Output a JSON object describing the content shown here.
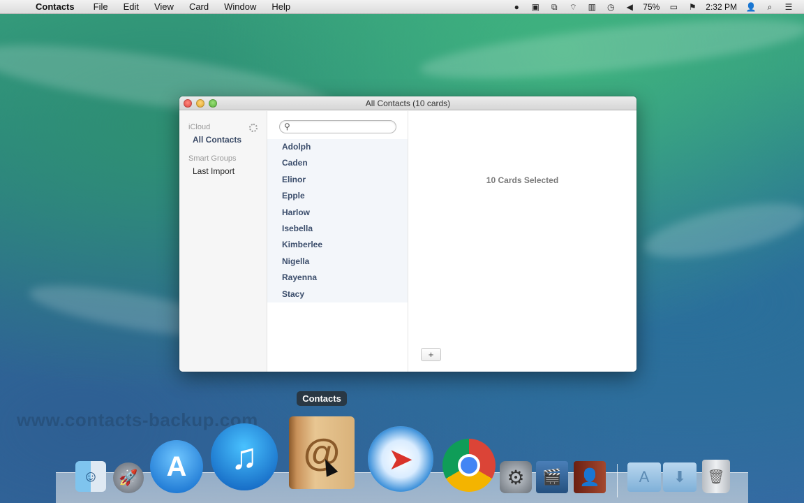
{
  "menubar": {
    "app_name": "Contacts",
    "items": [
      "File",
      "Edit",
      "View",
      "Card",
      "Window",
      "Help"
    ],
    "battery": "75%",
    "time": "2:32 PM",
    "icons": [
      "apple-icon",
      "bell-icon",
      "screen-icon",
      "windows-icon",
      "wifi-icon",
      "battery-box-icon",
      "time-machine-icon",
      "volume-icon",
      "battery-icon",
      "flag-icon",
      "user-icon",
      "spotlight-icon",
      "list-icon"
    ]
  },
  "window": {
    "title": "All Contacts (10 cards)",
    "sidebar": {
      "icloud_header": "iCloud",
      "all_contacts": "All Contacts",
      "smart_groups_header": "Smart Groups",
      "last_import": "Last Import"
    },
    "search": {
      "value": "",
      "placeholder": ""
    },
    "contacts": [
      "Adolph",
      "Caden",
      "Elinor",
      "Epple",
      "Harlow",
      "Isebella",
      "Kimberlee",
      "Nigella",
      "Rayenna",
      "Stacy"
    ],
    "detail": {
      "selected_text": "10 Cards Selected",
      "add_label": "+"
    }
  },
  "dock": {
    "tooltip": "Contacts",
    "watermark": "www.contacts-backup.com"
  }
}
